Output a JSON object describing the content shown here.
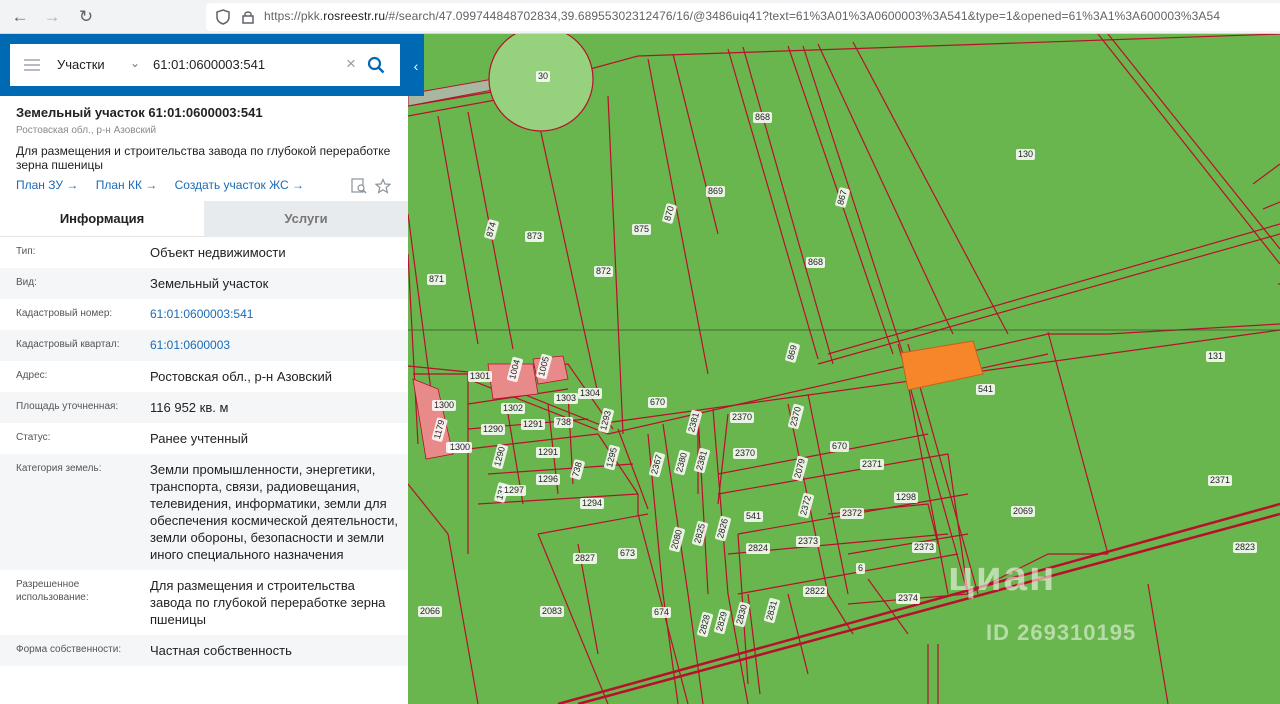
{
  "browser": {
    "url_prefix": "https://pkk.",
    "url_domain": "rosreestr.ru",
    "url_rest": "/#/search/47.099744848702834,39.68955302312476/16/@3486uiq41?text=61%3A01%3A0600003%3A541&type=1&opened=61%3A1%3A600003%3A54"
  },
  "search": {
    "type_label": "Участки",
    "query": "61:01:0600003:541"
  },
  "object": {
    "title": "Земельный участок 61:01:0600003:541",
    "region": "Ростовская обл., р-н Азовский",
    "purpose": "Для размещения и строительства завода по глубокой переработке зерна пшеницы",
    "links": [
      "План ЗУ →",
      "План КК →",
      "Создать участок ЖС →"
    ]
  },
  "tabs": {
    "info": "Информация",
    "services": "Услуги"
  },
  "details": [
    {
      "key": "Тип:",
      "value": "Объект недвижимости"
    },
    {
      "key": "Вид:",
      "value": "Земельный участок"
    },
    {
      "key": "Кадастровый номер:",
      "value": "61:01:0600003:541"
    },
    {
      "key": "Кадастровый квартал:",
      "value": "61:01:0600003"
    },
    {
      "key": "Адрес:",
      "value": "Ростовская обл., р-н Азовский"
    },
    {
      "key": "Площадь уточненная:",
      "value": "116 952 кв. м"
    },
    {
      "key": "Статус:",
      "value": "Ранее учтенный"
    },
    {
      "key": "Категория земель:",
      "value": "Земли промышленности, энергетики, транспорта, связи, радиовещания, телевидения, информатики, земли для обеспечения космической деятельности, земли обороны, безопасности и земли иного специального назначения"
    },
    {
      "key": "Разрешенное использование:",
      "value": "Для размещения и строительства завода по глубокой переработке зерна пшеницы"
    },
    {
      "key": "Форма собственности:",
      "value": "Частная собственность"
    }
  ],
  "map": {
    "parcel_labels": [
      "30",
      "868",
      "130",
      "869",
      "867",
      "874",
      "873",
      "875",
      "870",
      "868",
      "871",
      "872",
      "869",
      "131",
      "1301",
      "1004",
      "1005",
      "670",
      "541",
      "1300",
      "1302",
      "1303",
      "1304",
      "2370",
      "2370",
      "1179",
      "1290",
      "1291",
      "738",
      "1293",
      "2381",
      "1178",
      "1300",
      "670",
      "1290",
      "1291",
      "2367",
      "2380",
      "2381",
      "2370",
      "2079",
      "2371",
      "2371",
      "131",
      "1297",
      "1296",
      "738",
      "1295",
      "1294",
      "1298",
      "2069",
      "541",
      "2372",
      "2372",
      "2080",
      "2825",
      "2826",
      "2827",
      "673",
      "2824",
      "2373",
      "2373",
      "2823",
      "6",
      "2822",
      "2374",
      "2066",
      "2083",
      "674",
      "2828",
      "2829",
      "2830",
      "2831",
      "2374"
    ],
    "selected_color": "#f7862a",
    "watermark": "циан",
    "watermark_id": "ID 269310195"
  }
}
